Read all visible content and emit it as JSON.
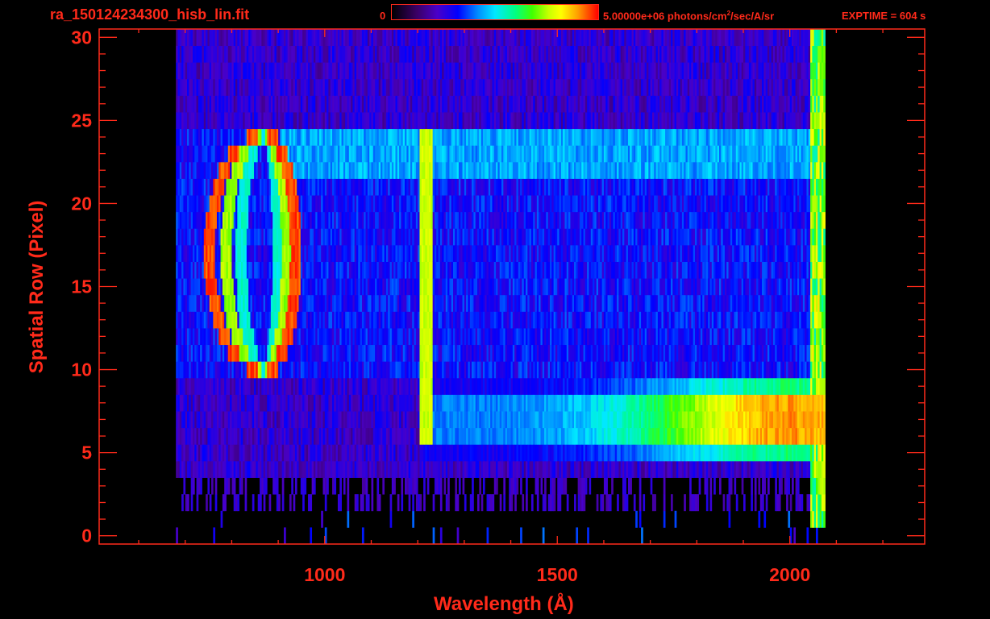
{
  "header": {
    "filename": "ra_150124234300_hisb_lin.fit",
    "colorbar_min": "0",
    "colorbar_max_prefix": "5.00000e+06 photons/cm",
    "colorbar_max_sup": "2",
    "colorbar_max_suffix": "/sec/A/sr",
    "exptime": "EXPTIME = 604 s"
  },
  "colors": {
    "axis": "#ff2a1a",
    "background": "#000000"
  },
  "chart_data": {
    "type": "heatmap",
    "title": "ra_150124234300_hisb_lin.fit",
    "xlabel": "Wavelength (Å)",
    "ylabel": "Spatial Row (Pixel)",
    "xlim": [
      515,
      2290
    ],
    "ylim": [
      -0.5,
      30.5
    ],
    "x_ticks": [
      1000,
      1500,
      2000
    ],
    "y_ticks": [
      0,
      5,
      10,
      15,
      20,
      25,
      30
    ],
    "colorbar": {
      "min": 0,
      "max": 5000000,
      "units": "photons/cm^2/sec/A/sr"
    },
    "colormap": "rainbow",
    "data_x_range": [
      680,
      2075
    ],
    "features": {
      "rings": {
        "center_wavelength": 870,
        "rows": [
          10,
          24
        ]
      },
      "vertical_line": {
        "wavelength": 1216,
        "rows": [
          6,
          24
        ]
      },
      "bright_band": {
        "wavelength_range": [
          1200,
          2075
        ],
        "rows": [
          5,
          9
        ],
        "peak_wavelength": 2000
      },
      "upper_band": {
        "wavelength_range": [
          900,
          2050
        ],
        "rows": [
          22,
          24
        ]
      }
    }
  }
}
